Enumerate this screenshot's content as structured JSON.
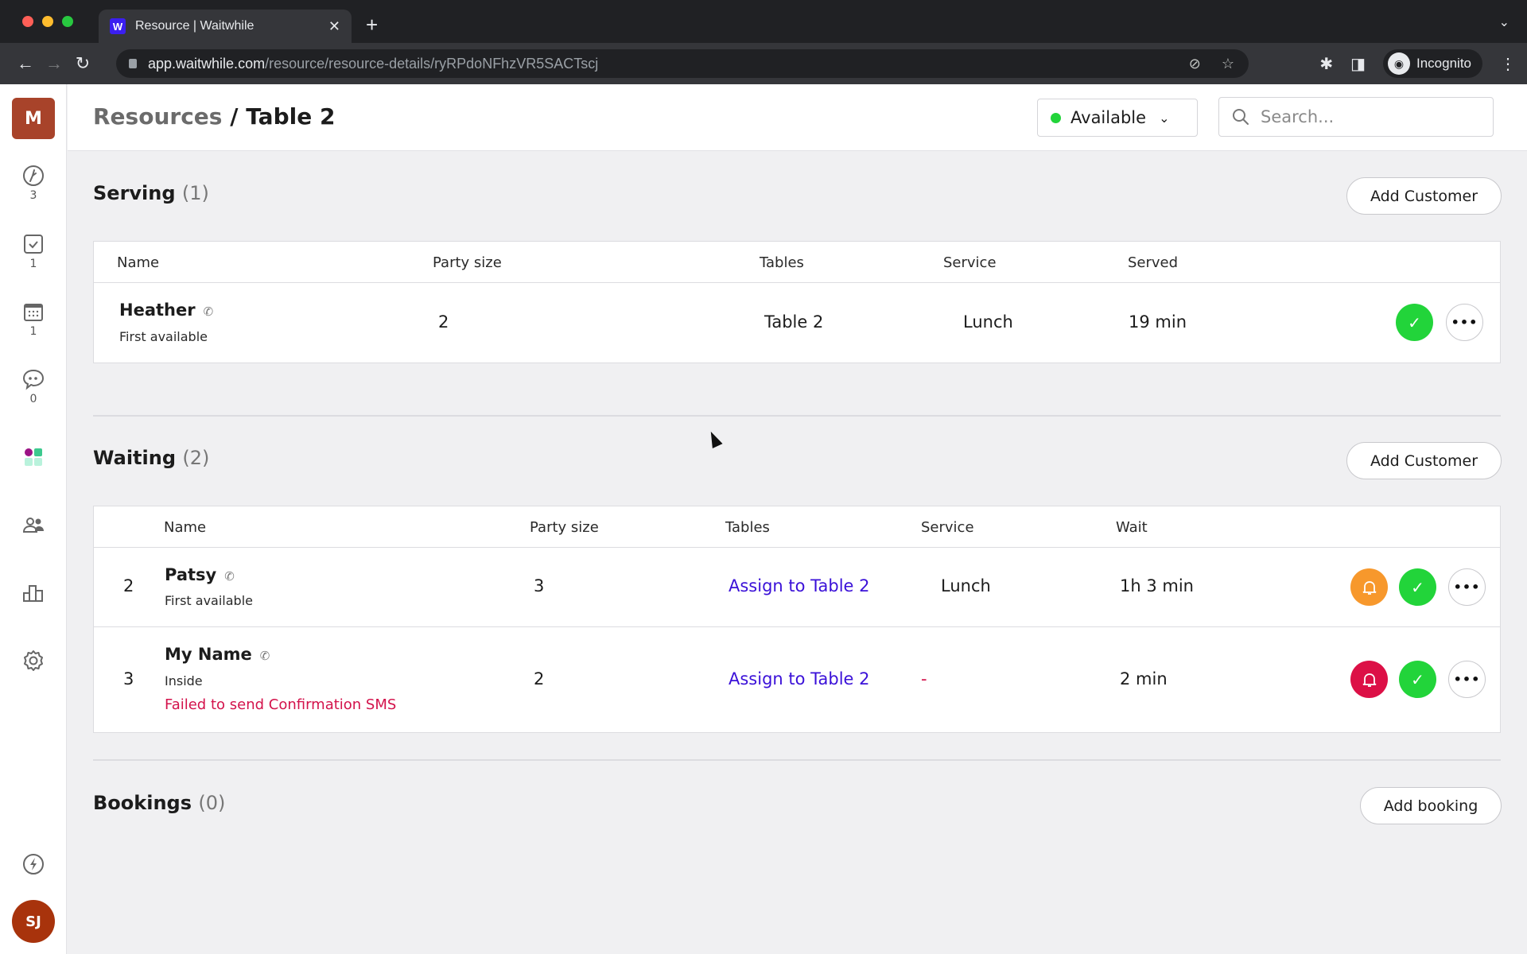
{
  "browser": {
    "tab_title": "Resource | Waitwhile",
    "tab_favicon": "W",
    "url_host": "app.waitwhile.com",
    "url_path": "/resource/resource-details/ryRPdoNFhzVR5SACTscj",
    "profile_label": "Incognito"
  },
  "sidebar": {
    "org_initial": "M",
    "items": [
      {
        "icon": "clock-icon",
        "count": "3"
      },
      {
        "icon": "checkbox-icon",
        "count": "1"
      },
      {
        "icon": "calendar-icon",
        "count": "1"
      },
      {
        "icon": "chat-icon",
        "count": "0"
      },
      {
        "icon": "apps-icon"
      },
      {
        "icon": "users-icon"
      },
      {
        "icon": "analytics-icon"
      },
      {
        "icon": "settings-icon"
      },
      {
        "icon": "lightning-icon"
      }
    ],
    "user_initials": "SJ"
  },
  "header": {
    "breadcrumb_parent": "Resources",
    "breadcrumb_sep": " / ",
    "breadcrumb_current": "Table 2",
    "status_label": "Available",
    "status_color": "#22d43a",
    "search_placeholder": "Search..."
  },
  "serving": {
    "title": "Serving",
    "count": "(1)",
    "add_label": "Add Customer",
    "columns": [
      "Name",
      "Party size",
      "Tables",
      "Service",
      "Served"
    ],
    "rows": [
      {
        "name": "Heather",
        "detail": "First available",
        "party_size": "2",
        "tables": "Table 2",
        "service": "Lunch",
        "served": "19 min"
      }
    ]
  },
  "waiting": {
    "title": "Waiting",
    "count": "(2)",
    "add_label": "Add Customer",
    "columns": [
      "Name",
      "Party size",
      "Tables",
      "Service",
      "Wait"
    ],
    "rows": [
      {
        "position": "2",
        "name": "Patsy",
        "detail": "First available",
        "error": "",
        "party_size": "3",
        "tables": "Assign to Table 2",
        "service": "Lunch",
        "wait": "1h 3 min",
        "notify_state": "pending"
      },
      {
        "position": "3",
        "name": "My Name",
        "detail": "Inside",
        "error": "Failed to send Confirmation SMS",
        "party_size": "2",
        "tables": "Assign to Table 2",
        "service": "-",
        "wait": "2 min",
        "notify_state": "failed"
      }
    ]
  },
  "bookings": {
    "title": "Bookings",
    "count": "(0)",
    "add_label": "Add booking"
  },
  "colors": {
    "accent_link": "#3a10d8",
    "success": "#22d43a",
    "warning": "#f7982c",
    "error": "#dc1046",
    "org_badge": "#a8432a"
  }
}
